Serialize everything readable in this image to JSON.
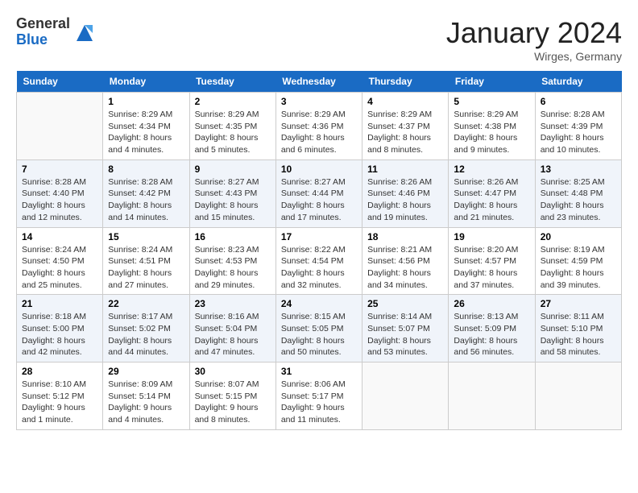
{
  "header": {
    "logo_general": "General",
    "logo_blue": "Blue",
    "month_title": "January 2024",
    "location": "Wirges, Germany"
  },
  "days_of_week": [
    "Sunday",
    "Monday",
    "Tuesday",
    "Wednesday",
    "Thursday",
    "Friday",
    "Saturday"
  ],
  "weeks": [
    [
      {
        "day": "",
        "sunrise": "",
        "sunset": "",
        "daylight": ""
      },
      {
        "day": "1",
        "sunrise": "Sunrise: 8:29 AM",
        "sunset": "Sunset: 4:34 PM",
        "daylight": "Daylight: 8 hours and 4 minutes."
      },
      {
        "day": "2",
        "sunrise": "Sunrise: 8:29 AM",
        "sunset": "Sunset: 4:35 PM",
        "daylight": "Daylight: 8 hours and 5 minutes."
      },
      {
        "day": "3",
        "sunrise": "Sunrise: 8:29 AM",
        "sunset": "Sunset: 4:36 PM",
        "daylight": "Daylight: 8 hours and 6 minutes."
      },
      {
        "day": "4",
        "sunrise": "Sunrise: 8:29 AM",
        "sunset": "Sunset: 4:37 PM",
        "daylight": "Daylight: 8 hours and 8 minutes."
      },
      {
        "day": "5",
        "sunrise": "Sunrise: 8:29 AM",
        "sunset": "Sunset: 4:38 PM",
        "daylight": "Daylight: 8 hours and 9 minutes."
      },
      {
        "day": "6",
        "sunrise": "Sunrise: 8:28 AM",
        "sunset": "Sunset: 4:39 PM",
        "daylight": "Daylight: 8 hours and 10 minutes."
      }
    ],
    [
      {
        "day": "7",
        "sunrise": "Sunrise: 8:28 AM",
        "sunset": "Sunset: 4:40 PM",
        "daylight": "Daylight: 8 hours and 12 minutes."
      },
      {
        "day": "8",
        "sunrise": "Sunrise: 8:28 AM",
        "sunset": "Sunset: 4:42 PM",
        "daylight": "Daylight: 8 hours and 14 minutes."
      },
      {
        "day": "9",
        "sunrise": "Sunrise: 8:27 AM",
        "sunset": "Sunset: 4:43 PM",
        "daylight": "Daylight: 8 hours and 15 minutes."
      },
      {
        "day": "10",
        "sunrise": "Sunrise: 8:27 AM",
        "sunset": "Sunset: 4:44 PM",
        "daylight": "Daylight: 8 hours and 17 minutes."
      },
      {
        "day": "11",
        "sunrise": "Sunrise: 8:26 AM",
        "sunset": "Sunset: 4:46 PM",
        "daylight": "Daylight: 8 hours and 19 minutes."
      },
      {
        "day": "12",
        "sunrise": "Sunrise: 8:26 AM",
        "sunset": "Sunset: 4:47 PM",
        "daylight": "Daylight: 8 hours and 21 minutes."
      },
      {
        "day": "13",
        "sunrise": "Sunrise: 8:25 AM",
        "sunset": "Sunset: 4:48 PM",
        "daylight": "Daylight: 8 hours and 23 minutes."
      }
    ],
    [
      {
        "day": "14",
        "sunrise": "Sunrise: 8:24 AM",
        "sunset": "Sunset: 4:50 PM",
        "daylight": "Daylight: 8 hours and 25 minutes."
      },
      {
        "day": "15",
        "sunrise": "Sunrise: 8:24 AM",
        "sunset": "Sunset: 4:51 PM",
        "daylight": "Daylight: 8 hours and 27 minutes."
      },
      {
        "day": "16",
        "sunrise": "Sunrise: 8:23 AM",
        "sunset": "Sunset: 4:53 PM",
        "daylight": "Daylight: 8 hours and 29 minutes."
      },
      {
        "day": "17",
        "sunrise": "Sunrise: 8:22 AM",
        "sunset": "Sunset: 4:54 PM",
        "daylight": "Daylight: 8 hours and 32 minutes."
      },
      {
        "day": "18",
        "sunrise": "Sunrise: 8:21 AM",
        "sunset": "Sunset: 4:56 PM",
        "daylight": "Daylight: 8 hours and 34 minutes."
      },
      {
        "day": "19",
        "sunrise": "Sunrise: 8:20 AM",
        "sunset": "Sunset: 4:57 PM",
        "daylight": "Daylight: 8 hours and 37 minutes."
      },
      {
        "day": "20",
        "sunrise": "Sunrise: 8:19 AM",
        "sunset": "Sunset: 4:59 PM",
        "daylight": "Daylight: 8 hours and 39 minutes."
      }
    ],
    [
      {
        "day": "21",
        "sunrise": "Sunrise: 8:18 AM",
        "sunset": "Sunset: 5:00 PM",
        "daylight": "Daylight: 8 hours and 42 minutes."
      },
      {
        "day": "22",
        "sunrise": "Sunrise: 8:17 AM",
        "sunset": "Sunset: 5:02 PM",
        "daylight": "Daylight: 8 hours and 44 minutes."
      },
      {
        "day": "23",
        "sunrise": "Sunrise: 8:16 AM",
        "sunset": "Sunset: 5:04 PM",
        "daylight": "Daylight: 8 hours and 47 minutes."
      },
      {
        "day": "24",
        "sunrise": "Sunrise: 8:15 AM",
        "sunset": "Sunset: 5:05 PM",
        "daylight": "Daylight: 8 hours and 50 minutes."
      },
      {
        "day": "25",
        "sunrise": "Sunrise: 8:14 AM",
        "sunset": "Sunset: 5:07 PM",
        "daylight": "Daylight: 8 hours and 53 minutes."
      },
      {
        "day": "26",
        "sunrise": "Sunrise: 8:13 AM",
        "sunset": "Sunset: 5:09 PM",
        "daylight": "Daylight: 8 hours and 56 minutes."
      },
      {
        "day": "27",
        "sunrise": "Sunrise: 8:11 AM",
        "sunset": "Sunset: 5:10 PM",
        "daylight": "Daylight: 8 hours and 58 minutes."
      }
    ],
    [
      {
        "day": "28",
        "sunrise": "Sunrise: 8:10 AM",
        "sunset": "Sunset: 5:12 PM",
        "daylight": "Daylight: 9 hours and 1 minute."
      },
      {
        "day": "29",
        "sunrise": "Sunrise: 8:09 AM",
        "sunset": "Sunset: 5:14 PM",
        "daylight": "Daylight: 9 hours and 4 minutes."
      },
      {
        "day": "30",
        "sunrise": "Sunrise: 8:07 AM",
        "sunset": "Sunset: 5:15 PM",
        "daylight": "Daylight: 9 hours and 8 minutes."
      },
      {
        "day": "31",
        "sunrise": "Sunrise: 8:06 AM",
        "sunset": "Sunset: 5:17 PM",
        "daylight": "Daylight: 9 hours and 11 minutes."
      },
      {
        "day": "",
        "sunrise": "",
        "sunset": "",
        "daylight": ""
      },
      {
        "day": "",
        "sunrise": "",
        "sunset": "",
        "daylight": ""
      },
      {
        "day": "",
        "sunrise": "",
        "sunset": "",
        "daylight": ""
      }
    ]
  ]
}
